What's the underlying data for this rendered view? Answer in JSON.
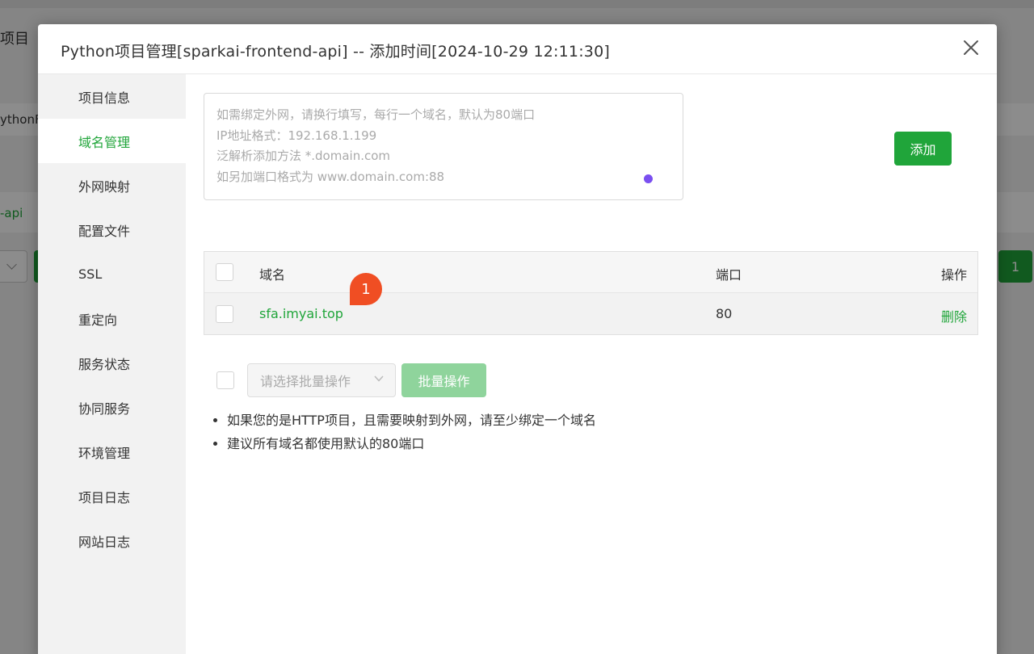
{
  "background": {
    "page_title": "项目",
    "row_text": "ythonF",
    "row_link": "-api",
    "right_button": "1"
  },
  "dialog": {
    "title": "Python项目管理[sparkai-frontend-api] -- 添加时间[2024-10-29 12:11:30]",
    "close_icon": "close-icon"
  },
  "sidebar": {
    "items": [
      {
        "label": "项目信息",
        "active": false
      },
      {
        "label": "域名管理",
        "active": true
      },
      {
        "label": "外网映射",
        "active": false
      },
      {
        "label": "配置文件",
        "active": false
      },
      {
        "label": "SSL",
        "active": false
      },
      {
        "label": "重定向",
        "active": false
      },
      {
        "label": "服务状态",
        "active": false
      },
      {
        "label": "协同服务",
        "active": false
      },
      {
        "label": "环境管理",
        "active": false
      },
      {
        "label": "项目日志",
        "active": false
      },
      {
        "label": "网站日志",
        "active": false
      }
    ]
  },
  "domain_input": {
    "value": "",
    "placeholder_lines": [
      "如需绑定外网，请换行填写，每行一个域名，默认为80端口",
      "IP地址格式：192.168.1.199",
      "泛解析添加方法 *.domain.com",
      "如另加端口格式为 www.domain.com:88"
    ]
  },
  "add_button": "添加",
  "table": {
    "headers": {
      "domain": "域名",
      "port": "端口",
      "action": "操作"
    },
    "rows": [
      {
        "domain": "sfa.imyai.top",
        "port": "80",
        "action": "删除"
      }
    ],
    "badge": "1"
  },
  "batch": {
    "select_placeholder": "请选择批量操作",
    "button": "批量操作"
  },
  "tips": [
    "如果您的是HTTP项目，且需要映射到外网，请至少绑定一个域名",
    "建议所有域名都使用默认的80端口"
  ],
  "colors": {
    "accent": "#20a53a",
    "accent_disabled": "#8fd49c",
    "badge": "#f04e23",
    "cursor_dot": "#7a4ff0"
  }
}
